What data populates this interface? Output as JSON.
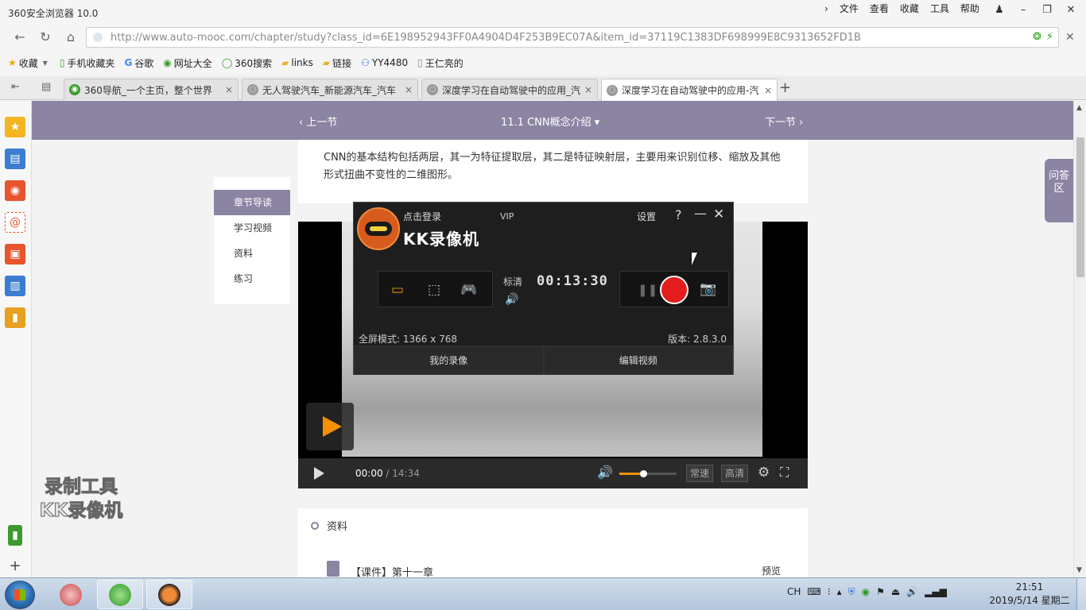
{
  "browser": {
    "title": "360安全浏览器 10.0",
    "menus": [
      "文件",
      "查看",
      "收藏",
      "工具",
      "帮助"
    ],
    "url": "http://www.auto-mooc.com/chapter/study?class_id=6E198952943FF0A4904D4F253B9EC07A&item_id=37119C1383DF698999E8C9313652FD1B",
    "bookmarks": [
      {
        "label": "收藏",
        "icon": "star-icon"
      },
      {
        "label": "手机收藏夹",
        "icon": "phone-icon"
      },
      {
        "label": "谷歌",
        "icon": "google-icon"
      },
      {
        "label": "网址大全",
        "icon": "globe-icon"
      },
      {
        "label": "360搜索",
        "icon": "search-icon"
      },
      {
        "label": "links",
        "icon": "folder-icon"
      },
      {
        "label": "链接",
        "icon": "folder-icon"
      },
      {
        "label": "YY4480",
        "icon": "yy-icon"
      },
      {
        "label": "王仁亮的",
        "icon": "page-icon"
      }
    ],
    "tabs": [
      {
        "label": "360导航_一个主页，整个世界",
        "active": false,
        "color": "#3d9a2f"
      },
      {
        "label": "无人驾驶汽车_新能源汽车_汽车",
        "active": false,
        "color": "#9a9a9a"
      },
      {
        "label": "深度学习在自动驾驶中的应用_汽",
        "active": false,
        "color": "#9a9a9a"
      },
      {
        "label": "深度学习在自动驾驶中的应用-汽",
        "active": true,
        "color": "#9a9a9a"
      }
    ]
  },
  "course": {
    "prev": "上一节",
    "current": "11.1 CNN概念介绍",
    "next": "下一节",
    "text": "CNN的基本结构包括两层，其一为特征提取层，其二是特征映射层，主要用来识别位移、缩放及其他形式扭曲不变性的二维图形。",
    "nav": [
      {
        "label": "章节导读",
        "active": true
      },
      {
        "label": "学习视频",
        "active": false
      },
      {
        "label": "资料",
        "active": false
      },
      {
        "label": "练习",
        "active": false
      }
    ],
    "qa": "问答区",
    "player": {
      "current_time": "00:00",
      "duration": "/ 14:34",
      "volume": 0.42,
      "speed": "常速",
      "quality": "高清"
    },
    "attachments": {
      "heading": "资料",
      "item_title": "【课件】第十一章",
      "preview": "预览"
    }
  },
  "kk": {
    "login": "点击登录",
    "vip": "VIP",
    "brand": "KK录像机",
    "settings": "设置",
    "help": "?",
    "quality": "标清",
    "timer": "00:13:30",
    "full_mode": "全屏模式: 1366 x 768",
    "version": "版本: 2.8.3.0",
    "my_recordings": "我的录像",
    "edit_video": "编辑视频"
  },
  "watermark": [
    "录制工具",
    "KK录像机"
  ],
  "taskbar": {
    "tray_lang": "CH",
    "time": "21:51",
    "date": "2019/5/14 星期二"
  },
  "colors": {
    "accent": "#8c84a3",
    "record": "#e51c1c",
    "orange": "#f39100"
  }
}
